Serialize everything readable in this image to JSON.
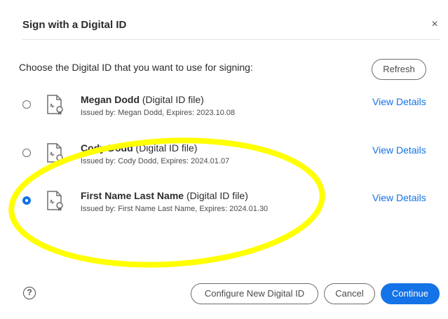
{
  "dialog": {
    "title": "Sign with a Digital ID",
    "close_glyph": "×",
    "prompt": "Choose the Digital ID that you want to use for signing:",
    "refresh_label": "Refresh"
  },
  "ids": [
    {
      "name": "Megan Dodd",
      "type": "(Digital ID file)",
      "issued": "Issued by: Megan Dodd, Expires: 2023.10.08",
      "view_label": "View Details",
      "selected": false
    },
    {
      "name": "Cody Dodd",
      "type": "(Digital ID file)",
      "issued": "Issued by: Cody Dodd, Expires: 2024.01.07",
      "view_label": "View Details",
      "selected": false
    },
    {
      "name": "First Name Last Name",
      "type": "(Digital ID file)",
      "issued": "Issued by: First Name Last Name, Expires: 2024.01.30",
      "view_label": "View Details",
      "selected": true
    }
  ],
  "footer": {
    "help_glyph": "?",
    "configure_label": "Configure New Digital ID",
    "cancel_label": "Cancel",
    "continue_label": "Continue"
  },
  "colors": {
    "accent": "#1473e6",
    "highlight": "#ffff00"
  },
  "icons": {
    "id_file": "certificate-document-icon",
    "help": "help-circle-icon",
    "close": "close-icon"
  }
}
